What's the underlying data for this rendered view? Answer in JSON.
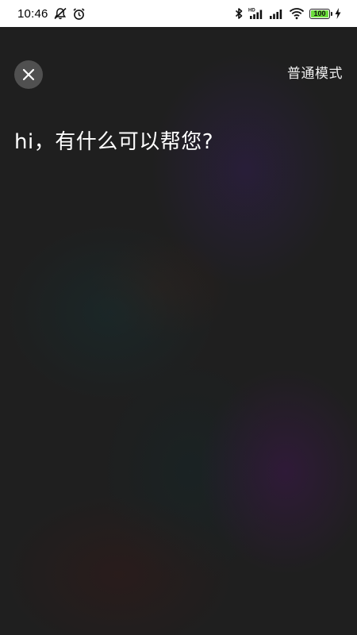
{
  "status_bar": {
    "time": "10:46",
    "left_icons": [
      "mute-notification-icon",
      "alarm-icon"
    ],
    "right_icons": [
      "bluetooth-icon",
      "hd-signal-icon",
      "signal-icon",
      "wifi-icon",
      "battery-icon",
      "charging-icon"
    ],
    "hd_label": "HD",
    "battery_level": "100",
    "battery_fraction": 1.0,
    "battery_color": "#6bdc3b"
  },
  "header": {
    "close_icon": "close-icon",
    "mode_label": "普通模式"
  },
  "assistant": {
    "greeting": "hi，有什么可以帮您?"
  }
}
